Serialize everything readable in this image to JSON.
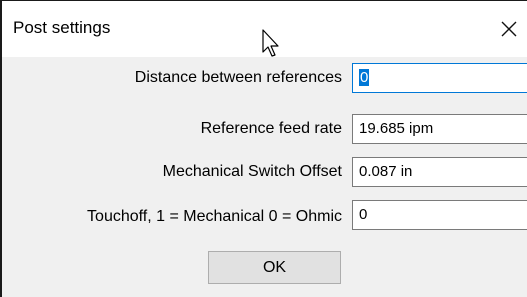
{
  "window": {
    "title": "Post settings",
    "close_glyph": "✕"
  },
  "fields": [
    {
      "label": "Distance between references",
      "value": "0"
    },
    {
      "label": "Reference feed rate",
      "value": "19.685 ipm"
    },
    {
      "label": "Mechanical Switch Offset",
      "value": "0.087 in"
    },
    {
      "label": "Touchoff, 1 = Mechanical 0 = Ohmic",
      "value": "0"
    }
  ],
  "buttons": {
    "ok_label": "OK"
  },
  "colors": {
    "accent": "#0078d7",
    "dialog_bg": "#f0f0f0",
    "button_bg": "#e1e1e1"
  }
}
